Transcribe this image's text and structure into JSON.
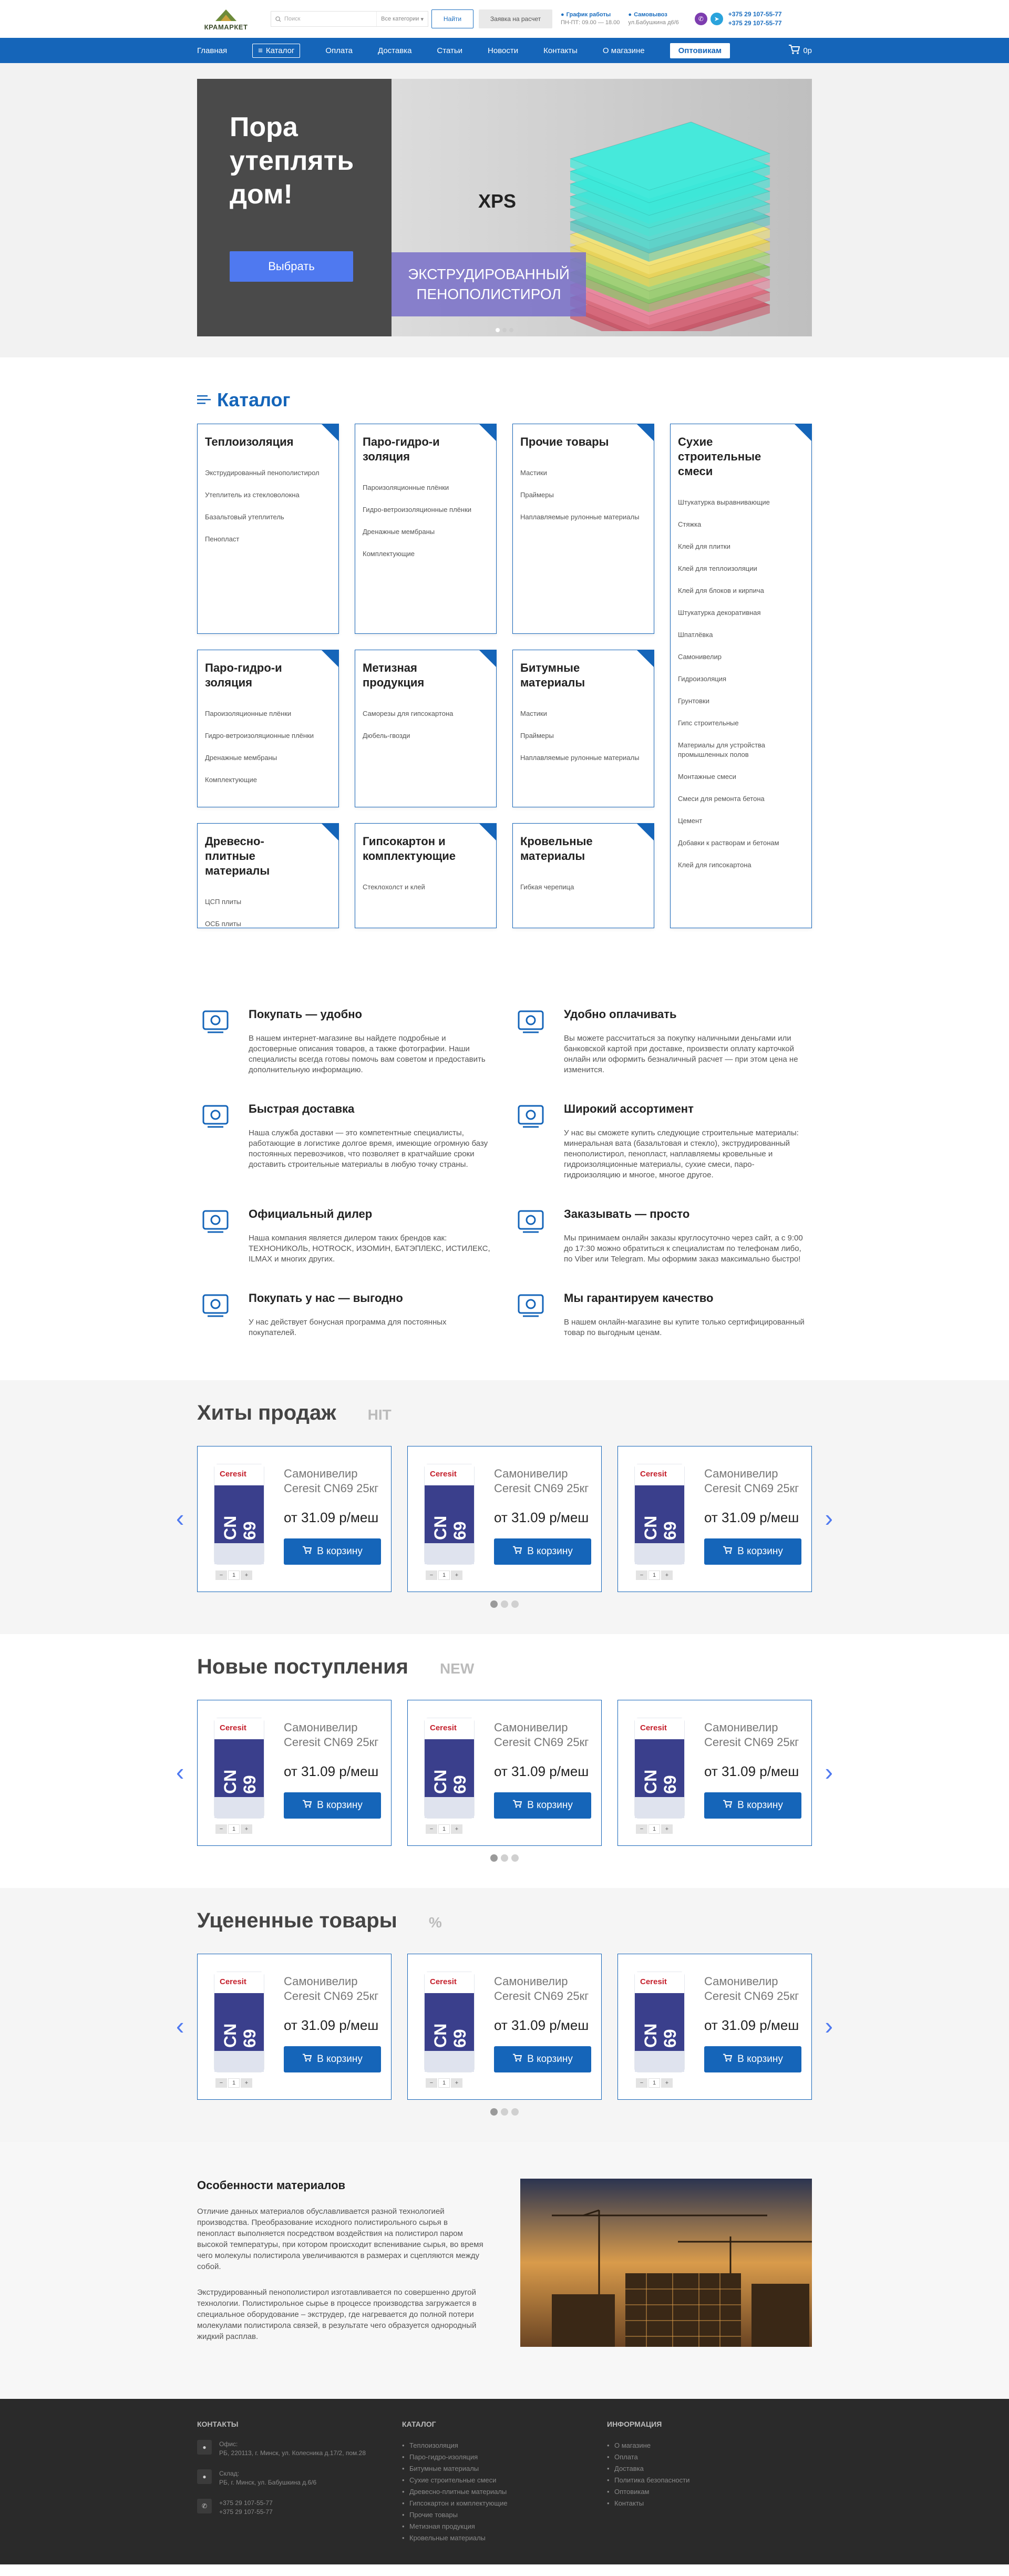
{
  "header": {
    "logo_text": "КРАМАРКЕТ",
    "search_placeholder": "Поиск",
    "search_category": "Все категории",
    "search_button": "Найти",
    "calc_button": "Заявка на расчет",
    "schedule_title": "График работы",
    "schedule_value": "ПН-ПТ: 09.00 — 18.00",
    "pickup_title": "Самовывоз",
    "pickup_value": "ул.Бабушкина д6/6",
    "phone1": "+375 29 107-55-77",
    "phone2": "+375 29 107-55-77"
  },
  "nav": {
    "items": [
      "Главная",
      "Каталог",
      "Оплата",
      "Доставка",
      "Статьи",
      "Новости",
      "Контакты",
      "О магазине"
    ],
    "wholesale": "Оптовикам",
    "cart_amount": "0р"
  },
  "hero": {
    "title": "Пора утеплять дом!",
    "button": "Выбрать",
    "product_label": "ЭКСТРУДИРОВАННЫЙ ПЕНОПОЛИСТИРОЛ",
    "brand_mark": "XPS"
  },
  "catalog": {
    "title": "Каталог",
    "cards": [
      {
        "title": "Теплоизоляция",
        "items": [
          "Экструдированный пенополистирол",
          "Утеплитель из стекловолокна",
          "Базальтовый утеплитель",
          "Пенопласт"
        ]
      },
      {
        "title": "Паро-гидро-и золяция",
        "items": [
          "Пароизоляционные плёнки",
          "Гидро-ветроизоляционные плёнки",
          "Дренажные мембраны",
          "Комплектующие"
        ]
      },
      {
        "title": "Прочие товары",
        "items": [
          "Мастики",
          "Праймеры",
          "Наплавляемые рулонные материалы"
        ]
      },
      {
        "title": "Сухие строительные смеси",
        "items": [
          "Штукатурка выравнивающие",
          "Стяжка",
          "Клей для плитки",
          "Клей для теплоизоляции",
          "Клей для блоков и кирпича",
          "Штукатурка декоративная",
          "Шпатлёвка",
          "Самонивелир",
          "Гидроизоляция",
          "Грунтовки",
          "Гипс строительные",
          "Материалы для устройства промышленных полов",
          "Монтажные смеси",
          "Смеси для ремонта бетона",
          "Цемент",
          "Добавки к растворам и бетонам",
          "Клей для гипсокартона"
        ]
      },
      {
        "title": "Паро-гидро-и золяция",
        "items": [
          "Пароизоляционные плёнки",
          "Гидро-ветроизоляционные плёнки",
          "Дренажные мембраны",
          "Комплектующие"
        ]
      },
      {
        "title": "Метизная продукция",
        "items": [
          "Саморезы для гипсокартона",
          "Дюбель-гвозди"
        ]
      },
      {
        "title": "Битумные материалы",
        "items": [
          "Мастики",
          "Праймеры",
          "Наплавляемые рулонные материалы"
        ]
      },
      {
        "title": "Древесно-плитные материалы",
        "items": [
          "ЦСП плиты",
          "OCБ плиты"
        ]
      },
      {
        "title": "Гипсокартон и комплектующие",
        "items": [
          "Стеклохолст и клей"
        ]
      },
      {
        "title": "Кровельные материалы",
        "items": [
          "Гибкая черепица"
        ]
      }
    ]
  },
  "features": [
    {
      "title": "Покупать — удобно",
      "text": "В нашем интернет-магазине вы найдете подробные и достоверные описания товаров, а также фотографии. Наши специалисты всегда готовы помочь вам советом и предоставить дополнительную информацию."
    },
    {
      "title": "Удобно оплачивать",
      "text": "Вы можете рассчитаться за покупку наличными деньгами или банковской картой при доставке, произвести оплату карточкой онлайн или оформить безналичный расчет — при этом цена не изменится."
    },
    {
      "title": "Быстрая доставка",
      "text": "Наша служба доставки — это компетентные специалисты, работающие в логистике долгое время, имеющие огромную базу постоянных перевозчиков, что позволяет в кратчайшие сроки доставить строительные материалы в любую точку страны."
    },
    {
      "title": "Широкий ассортимент",
      "text": "У нас вы сможете купить следующие строительные материалы: минеральная вата (базальтовая и стекло), экструдированный пенополистирол, пенопласт, наплавляемы кровельные и гидроизоляционные материалы, сухие смеси, паро-гидроизоляцию и многое, многое другое."
    },
    {
      "title": "Официальный дилер",
      "text": "Наша компания является дилером таких брендов как: ТЕХНОНИКОЛЬ, HOTROCK, ИЗОМИН, БАТЭПЛЕКС, ИСТИЛЕКС, ILMAX и многих других."
    },
    {
      "title": "Заказывать — просто",
      "text": "Мы принимаем онлайн заказы круглосуточно через сайт, а с 9:00 до 17:30 можно обратиться к специалистам по телефонам либо, по Viber или Telegram. Мы оформим заказ максимально быстро!"
    },
    {
      "title": "Покупать у нас — выгодно",
      "text": "У нас действует бонусная программа для постоянных покупателей."
    },
    {
      "title": "Мы гарантируем качество",
      "text": "В нашем онлайн-магазине вы купите только сертифицированный товар по выгодным ценам."
    }
  ],
  "sections": [
    {
      "title": "Хиты продаж",
      "tag": "HIT"
    },
    {
      "title": "Новые поступления",
      "tag": "NEW"
    },
    {
      "title": "Уцененные товары",
      "tag": "%"
    }
  ],
  "product": {
    "name": "Самонивелир Ceresit CN69 25кг",
    "price": "от 31.09 р/меш",
    "button": "В корзину",
    "qty": "1",
    "minus": "−",
    "plus": "+",
    "brand": "Ceresit",
    "code": "CN 69"
  },
  "about": {
    "title": "Особенности материалов",
    "p1": "Отличие данных материалов обуславливается разной технологией производства. Преобразование исходного полистирольного сырья в пенопласт выполняется посредством воздействия на полистирол паром высокой температуры, при котором происходит вспенивание сырья, во время чего молекулы полистирола увеличиваются в размерах и сцепляются между собой.",
    "p2": "Экструдированный пенополистирол изготавливается по совершенно другой технологии. Полистирольное сырье в процессе производства загружается в специальное оборудование – экструдер, где нагревается до полной потери молекулами полистирола связей, в результате чего образуется однородный жидкий расплав."
  },
  "footer": {
    "contacts_title": "КОНТАКТЫ",
    "catalog_title": "КАТАЛОГ",
    "info_title": "ИНФОРМАЦИЯ",
    "office_label": "Офис:",
    "office_value": "РБ, 220113, г. Минск, ул. Колесника д.17/2, пом.28",
    "store_label": "Склад:",
    "store_value": "РБ, г. Минск, ул. Бабушкина д.6/6",
    "phone_a": "+375 29 107-55-77",
    "phone_b": "+375 29 107-55-77",
    "catalog_links": [
      "Теплоизоляция",
      "Паро-гидро-изоляция",
      "Битумные материалы",
      "Сухие строительные смеси",
      "Древесно-плитные материалы",
      "Гипсокартон и комплектующие",
      "Прочие товары",
      "Метизная продукция",
      "Кровельные материалы"
    ],
    "info_links": [
      "О магазине",
      "Оплата",
      "Доставка",
      "Политика безопасности",
      "Оптовикам",
      "Контакты"
    ]
  }
}
